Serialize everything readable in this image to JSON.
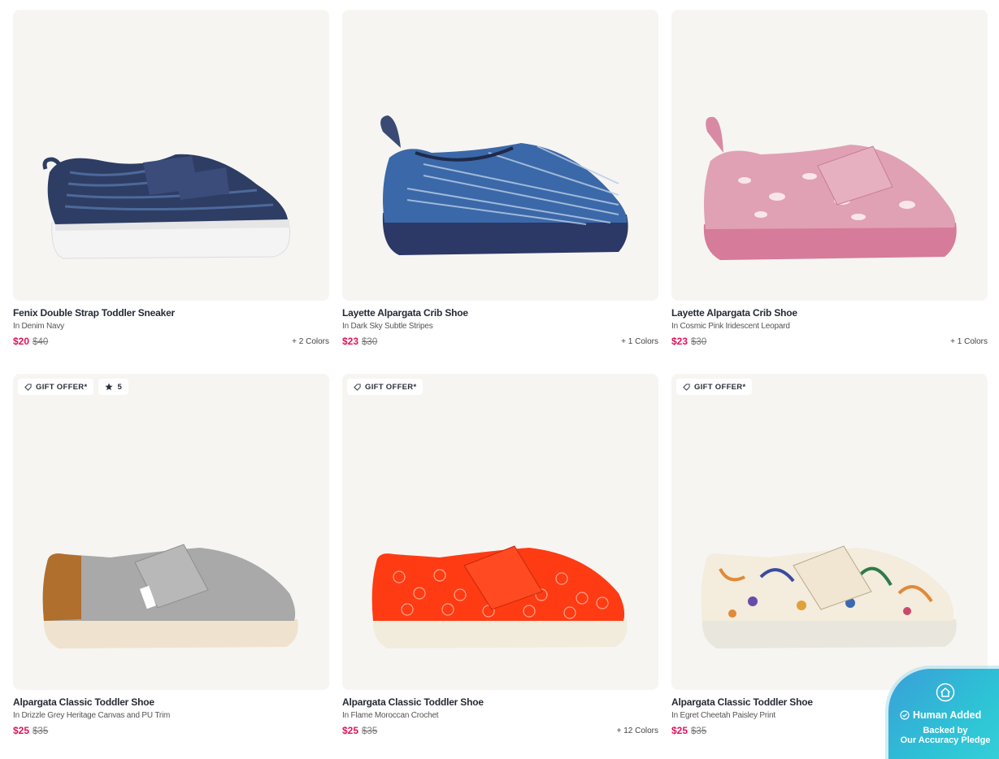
{
  "products": [
    {
      "name": "Fenix Double Strap Toddler Sneaker",
      "variant": "In Denim Navy",
      "price": "$20",
      "was": "$40",
      "colors": "+ 2 Colors",
      "badges": []
    },
    {
      "name": "Layette Alpargata Crib Shoe",
      "variant": "In Dark Sky Subtle Stripes",
      "price": "$23",
      "was": "$30",
      "colors": "+ 1 Colors",
      "badges": []
    },
    {
      "name": "Layette Alpargata Crib Shoe",
      "variant": "In Cosmic Pink Iridescent Leopard",
      "price": "$23",
      "was": "$30",
      "colors": "+ 1 Colors",
      "badges": []
    },
    {
      "name": "Alpargata Classic Toddler Shoe",
      "variant": "In Drizzle Grey Heritage Canvas and PU Trim",
      "price": "$25",
      "was": "$35",
      "colors": "",
      "badges": [
        "GIFT OFFER*",
        "5"
      ]
    },
    {
      "name": "Alpargata Classic Toddler Shoe",
      "variant": "In Flame Moroccan Crochet",
      "price": "$25",
      "was": "$35",
      "colors": "+ 12 Colors",
      "badges": [
        "GIFT OFFER*"
      ]
    },
    {
      "name": "Alpargata Classic Toddler Shoe",
      "variant": "In Egret Cheetah Paisley Print",
      "price": "$25",
      "was": "$35",
      "colors": "",
      "badges": [
        "GIFT OFFER*"
      ]
    }
  ],
  "pledge": {
    "line1": "Human Added",
    "line2": "Backed by",
    "line3": "Our Accuracy Pledge"
  },
  "colors": {
    "sale_price": "#e0135b",
    "card_bg": "#f6f5f2",
    "pledge_bg": "#2dc2d6"
  }
}
